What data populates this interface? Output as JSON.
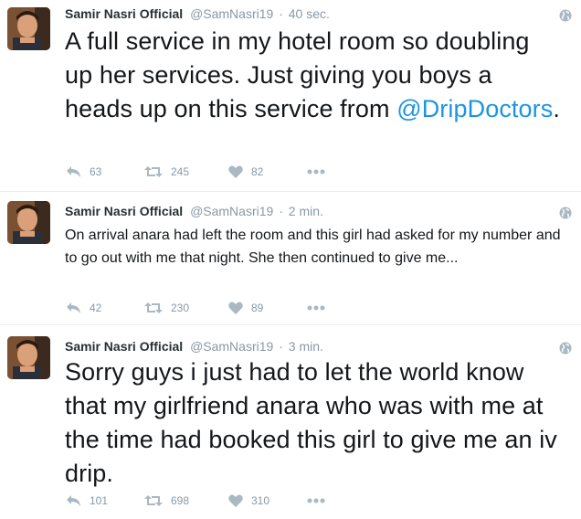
{
  "tweets": [
    {
      "name": "Samir Nasri Official",
      "handle": "@SamNasri19",
      "separator": "·",
      "time": "40 sec.",
      "text_before": "A full service in my hotel room so doubling up her services. Just giving you boys a heads up on this service from ",
      "mention": "@DripDoctors",
      "text_after": ".",
      "replies": "63",
      "retweets": "245",
      "likes": "82"
    },
    {
      "name": "Samir Nasri Official",
      "handle": "@SamNasri19",
      "separator": "·",
      "time": "2 min.",
      "text": "On arrival anara had left the room and this girl had asked for my number and to go out with me that night. She then continued to give me...",
      "replies": "42",
      "retweets": "230",
      "likes": "89"
    },
    {
      "name": "Samir Nasri Official",
      "handle": "@SamNasri19",
      "separator": "·",
      "time": "3 min.",
      "text": "Sorry guys i just had to let the world know that my girlfriend anara who was with me at the time had booked this girl to give me an iv drip.",
      "replies": "101",
      "retweets": "698",
      "likes": "310"
    }
  ],
  "icons": {
    "reply": "reply-icon",
    "retweet": "retweet-icon",
    "like": "heart-icon",
    "more": "more-dots-icon",
    "privacy": "globe-icon"
  },
  "colors": {
    "text": "#14171a",
    "muted": "#8899a6",
    "mention": "#1b95e0",
    "divider": "#e6ecf0"
  }
}
